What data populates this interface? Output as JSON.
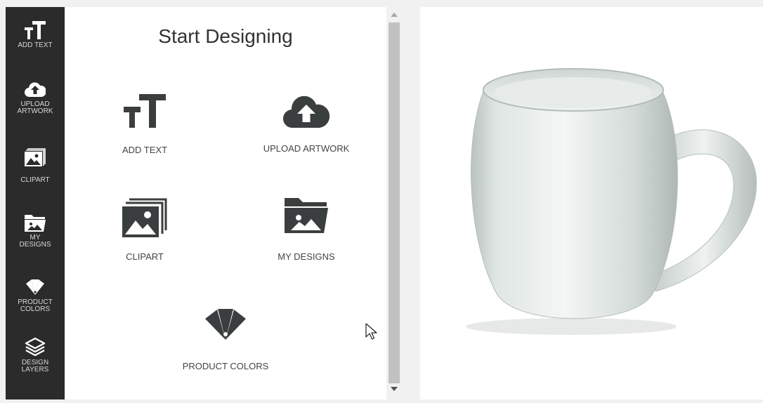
{
  "sidebar": {
    "items": [
      {
        "label": "ADD TEXT",
        "icon": "text-icon"
      },
      {
        "label": "UPLOAD ARTWORK",
        "icon": "upload-cloud-icon"
      },
      {
        "label": "CLIPART",
        "icon": "clipart-icon"
      },
      {
        "label": "MY DESIGNS",
        "icon": "folder-image-icon"
      },
      {
        "label": "PRODUCT COLORS",
        "icon": "color-swatch-icon"
      },
      {
        "label": "DESIGN LAYERS",
        "icon": "layers-icon"
      }
    ]
  },
  "panel": {
    "title": "Start Designing",
    "tiles": [
      {
        "label": "ADD TEXT",
        "icon": "text-icon"
      },
      {
        "label": "UPLOAD ARTWORK",
        "icon": "upload-cloud-icon"
      },
      {
        "label": "CLIPART",
        "icon": "clipart-icon"
      },
      {
        "label": "MY DESIGNS",
        "icon": "folder-image-icon"
      },
      {
        "label": "PRODUCT COLORS",
        "icon": "color-swatch-icon"
      }
    ]
  },
  "canvas": {
    "product": "mug-image"
  },
  "colors": {
    "rail_bg": "#2b2b2b",
    "icon_dark": "#3a3e3e",
    "panel_bg": "#ffffff"
  }
}
